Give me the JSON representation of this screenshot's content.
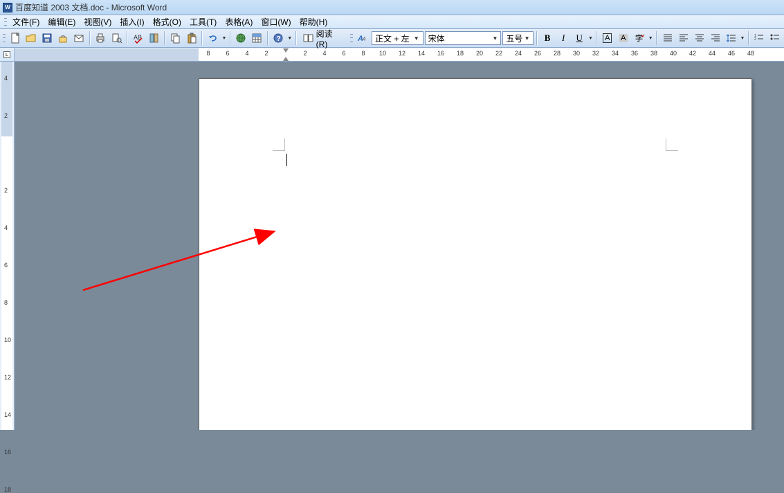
{
  "title_bar": {
    "title": "百度知道 2003 文档.doc - Microsoft Word",
    "app_icon_letter": "W"
  },
  "menu": {
    "file": "文件(F)",
    "edit": "编辑(E)",
    "view": "视图(V)",
    "insert": "插入(I)",
    "format": "格式(O)",
    "tools": "工具(T)",
    "table": "表格(A)",
    "window": "窗口(W)",
    "help": "帮助(H)"
  },
  "toolbar": {
    "reading_label": "阅读(R)",
    "style_value": "正文 + 左",
    "font_value": "宋体",
    "size_value": "五号",
    "bold": "B",
    "italic": "I",
    "underline": "U",
    "chinese_a": "A"
  },
  "ruler_h": {
    "left_nums": [
      "8",
      "6",
      "4",
      "2"
    ],
    "right_nums": [
      "2",
      "4",
      "6",
      "8",
      "10",
      "12",
      "14",
      "16",
      "18",
      "20",
      "22",
      "24",
      "26",
      "28",
      "30",
      "32",
      "34",
      "36",
      "38",
      "40",
      "42",
      "44",
      "46",
      "48"
    ]
  },
  "ruler_v": {
    "top_nums": [
      "4",
      "2"
    ],
    "body_nums": [
      "2",
      "4",
      "6",
      "8",
      "10",
      "12",
      "14",
      "16",
      "18"
    ]
  },
  "corner_btn": "L",
  "chart_data": null
}
